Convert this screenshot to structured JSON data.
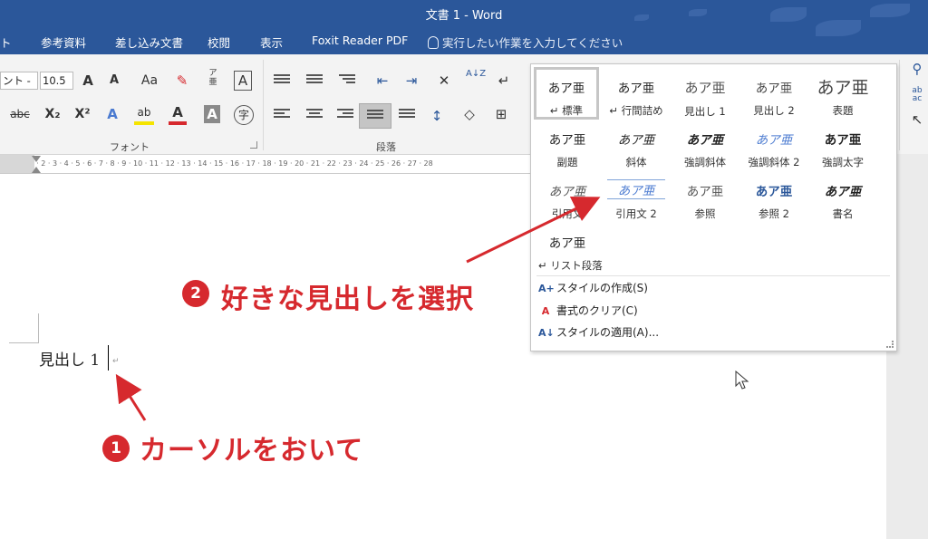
{
  "app": {
    "title": "文書 1  -  Word"
  },
  "tabs": [
    {
      "label": "ト"
    },
    {
      "label": "参考資料"
    },
    {
      "label": "差し込み文書"
    },
    {
      "label": "校閲"
    },
    {
      "label": "表示"
    },
    {
      "label": "Foxit Reader PDF"
    }
  ],
  "tell_me": {
    "placeholder": "実行したい作業を入力してください"
  },
  "ribbon": {
    "font_name": "ント -",
    "font_size": "10.5",
    "groups": {
      "font": "フォント",
      "paragraph": "段落"
    },
    "buttons": {
      "grow": "A",
      "shrink": "A",
      "case": "Aa",
      "phonetic_top": "ア",
      "phonetic_bottom": "亜",
      "boxed": "A",
      "strike": "abc",
      "subscript": "X₂",
      "superscript": "X²",
      "effects": "A",
      "highlight": "ab",
      "font_color": "A",
      "char_shade": "A",
      "enclose": "字",
      "sort": "A↓Z"
    }
  },
  "ruler": {
    "ticks": "2 · 1 · · 1 · 2 · 3 · 4 · 5 · 6 · 7 · 8 · 9 · 10 · 11 · 12 · 13 · 14 · 15 · 16 · 17 · 18 · 19 · 20 · 21 · 22 · 23 · 24 · 25 · 26 · 27 · 28"
  },
  "document": {
    "text": "見出し 1",
    "para_mark": "↵"
  },
  "style_gallery": {
    "styles": [
      {
        "preview": "あア亜",
        "label": "↵ 標準",
        "selected": true
      },
      {
        "preview": "あア亜",
        "label": "↵ 行間詰め"
      },
      {
        "preview": "あア亜",
        "label": "見出し 1"
      },
      {
        "preview": "あア亜",
        "label": "見出し 2"
      },
      {
        "preview": "あア亜",
        "label": "表題"
      },
      {
        "preview": "あア亜",
        "label": "副題"
      },
      {
        "preview": "あア亜",
        "label": "斜体"
      },
      {
        "preview": "あア亜",
        "label": "強調斜体"
      },
      {
        "preview": "あア亜",
        "label": "強調斜体 2"
      },
      {
        "preview": "あア亜",
        "label": "強調太字"
      },
      {
        "preview": "あア亜",
        "label": "引用文"
      },
      {
        "preview": "あア亜",
        "label": "引用文 2"
      },
      {
        "preview": "あア亜",
        "label": "参照"
      },
      {
        "preview": "あア亜",
        "label": "参照 2"
      },
      {
        "preview": "あア亜",
        "label": "書名"
      },
      {
        "preview": "あア亜",
        "label": "↵ リスト段落"
      }
    ],
    "commands": {
      "create": "スタイルの作成(S)",
      "clear": "書式のクリア(C)",
      "apply": "スタイルの適用(A)..."
    }
  },
  "annotations": {
    "step1": {
      "num": "1",
      "text": "カーソルをおいて"
    },
    "step2": {
      "num": "2",
      "text": "好きな見出しを選択"
    }
  },
  "colors": {
    "brand": "#2b579a",
    "annotation": "#d6292e"
  }
}
